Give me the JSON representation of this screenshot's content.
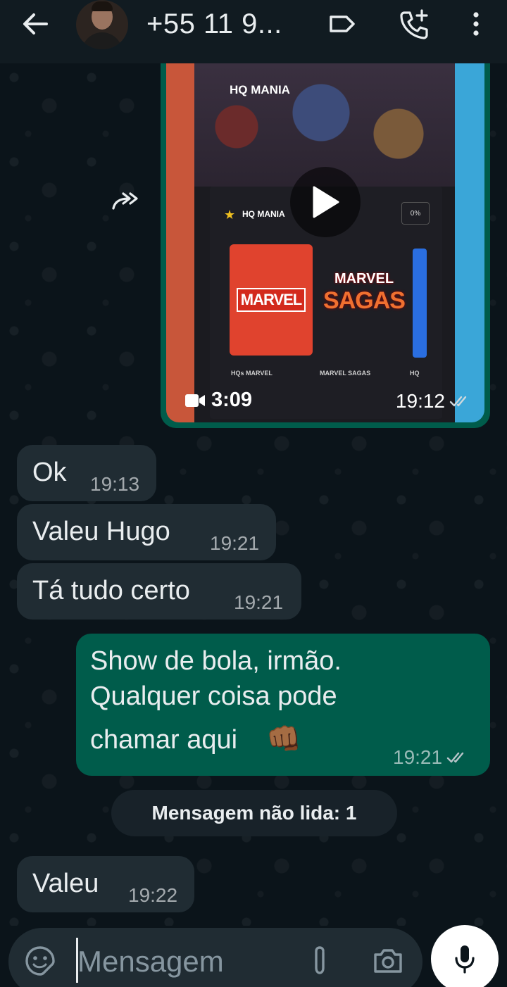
{
  "header": {
    "title": "+55 11 9...",
    "icons": [
      "back-arrow-icon",
      "label-icon",
      "add-call-icon",
      "more-vert-icon"
    ]
  },
  "video_message": {
    "app_title": "HQ MANIA",
    "app_subtitle": "HQ MANIA",
    "percent": "0%",
    "marvel_logo": "MARVEL",
    "sagas_top": "MARVEL",
    "sagas_bottom": "SAGAS",
    "card_labels": [
      "HQs MARVEL",
      "MARVEL SAGAS",
      "HQ"
    ],
    "duration": "3:09",
    "time": "19:12"
  },
  "messages": [
    {
      "dir": "in",
      "text": "Ok",
      "time": "19:13"
    },
    {
      "dir": "in",
      "text": "Valeu Hugo",
      "time": "19:21"
    },
    {
      "dir": "in",
      "text": "Tá tudo certo",
      "time": "19:21"
    },
    {
      "dir": "out",
      "lines": [
        "Show de bola, irmão.",
        "Qualquer coisa pode",
        "chamar aqui"
      ],
      "emoji": "👊🏾",
      "time": "19:21"
    },
    {
      "dir": "in",
      "text": "Valeu",
      "time": "19:22"
    }
  ],
  "unread_banner": "Mensagem não lida: 1",
  "composer": {
    "placeholder": "Mensagem"
  },
  "colors": {
    "background": "#0b141a",
    "header": "#111b21",
    "incoming_bubble": "#202c33",
    "outgoing_bubble": "#005c4b",
    "tick_gray": "#8696a0"
  }
}
